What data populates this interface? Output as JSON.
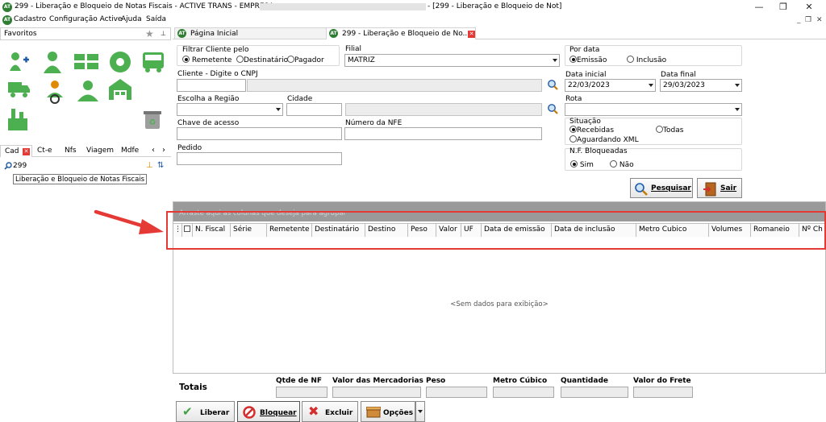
{
  "window": {
    "title": "299 - Liberação e Bloqueio de Notas Fiscais - ACTIVE TRANS - EMPRESA",
    "title_suffix": "- [299 - Liberação e Bloqueio de Not]",
    "minimize": "—",
    "restore": "❐",
    "close": "✕",
    "mdi_min": "_",
    "mdi_restore": "❐",
    "mdi_close": "✕"
  },
  "menu": [
    "Cadastro",
    "Configuração Active",
    "Ajuda",
    "Saída"
  ],
  "sidebar": {
    "favorites_label": "Favoritos",
    "tabs": [
      "Cad",
      "Ct-e",
      "Nfs",
      "Viagem",
      "Mdfe"
    ],
    "search_value": "299",
    "result_item": "Liberação e Bloqueio de Notas Fiscais"
  },
  "tabs": [
    {
      "label": "Página Inicial"
    },
    {
      "label": "299 - Liberação e Bloqueio de No..."
    }
  ],
  "filters": {
    "filter_by_label": "Filtrar Cliente pelo",
    "filter_options": [
      "Remetente",
      "Destinatário",
      "Pagador"
    ],
    "filial_label": "Filial",
    "filial_value": "MATRIZ",
    "por_data_label": "Por data",
    "por_data_options": [
      "Emissão",
      "Inclusão"
    ],
    "cliente_label": "Cliente - Digite o CNPJ",
    "data_inicial_label": "Data inicial",
    "data_inicial_value": "22/03/2023",
    "data_final_label": "Data final",
    "data_final_value": "29/03/2023",
    "regiao_label": "Escolha a Região",
    "cidade_label": "Cidade",
    "rota_label": "Rota",
    "chave_label": "Chave de acesso",
    "numero_nfe_label": "Número da NFE",
    "situacao_label": "Situação",
    "situacao_options": [
      "Recebidas",
      "Todas",
      "Aguardando XML"
    ],
    "pedido_label": "Pedido",
    "nf_bloqueadas_label": "N.F. Bloqueadas",
    "nf_bloqueadas_options": [
      "Sim",
      "Não"
    ]
  },
  "actions": {
    "pesquisar": "Pesquisar",
    "sair": "Sair"
  },
  "grid": {
    "group_hint": "Arraste aqui as colunas que deseja para agrupar",
    "columns": [
      "N. Fiscal",
      "Série",
      "Remetente",
      "Destinatário",
      "Destino",
      "Peso",
      "Valor",
      "UF",
      "Data de emissão",
      "Data de inclusão",
      "Metro Cubico",
      "Volumes",
      "Romaneio",
      "Nº Ch"
    ],
    "empty_text": "<Sem dados para exibição>"
  },
  "totals": {
    "label": "Totais",
    "fields": [
      "Qtde de NF",
      "Valor das Mercadorias",
      "Peso",
      "Metro Cúbico",
      "Quantidade",
      "Valor do Frete"
    ]
  },
  "bottom_buttons": [
    "Liberar",
    "Bloquear",
    "Excluir",
    "Opções"
  ],
  "colors": {
    "accent_green": "#2e7d32",
    "annotation_red": "#e53935",
    "group_bar": "#9a9a9a"
  }
}
